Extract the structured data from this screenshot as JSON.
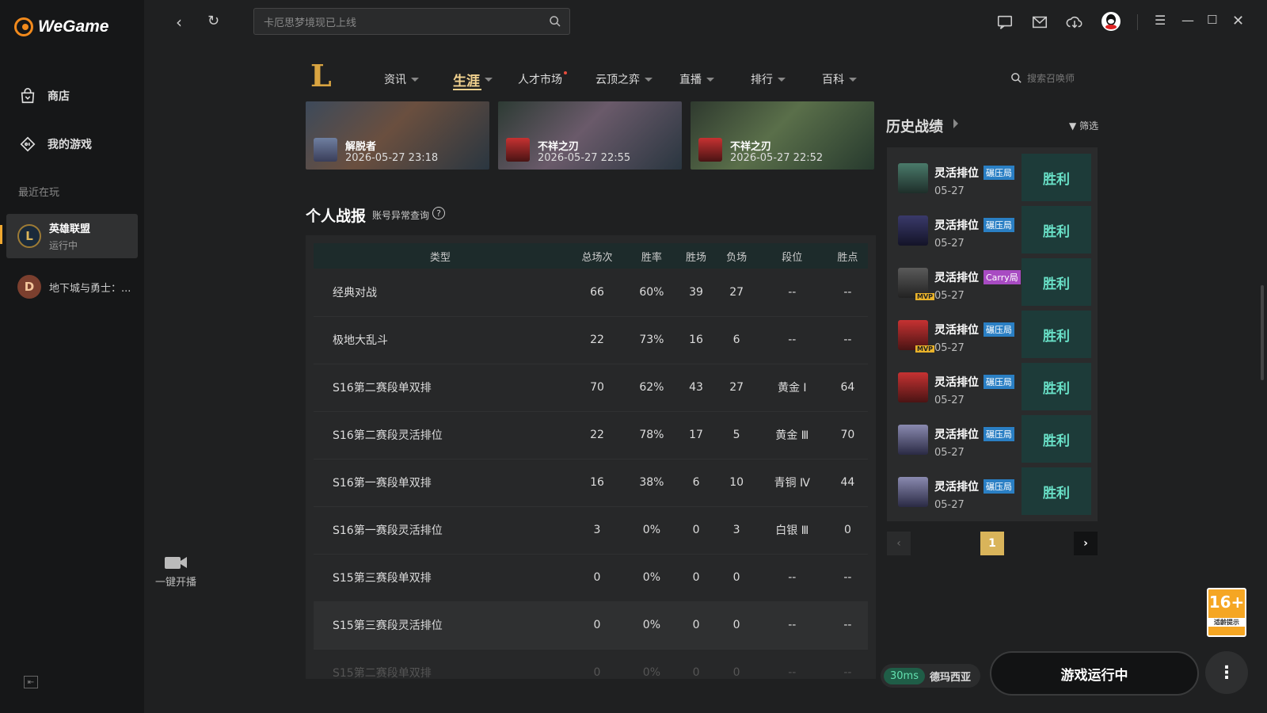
{
  "app": {
    "brand": "WeGame"
  },
  "sidebar": {
    "store": "商店",
    "my_games": "我的游戏",
    "recent_label": "最近在玩",
    "games": [
      {
        "name": "英雄联盟",
        "status": "运行中"
      },
      {
        "name": "地下城与勇士：..."
      }
    ]
  },
  "topbar": {
    "search_placeholder": "卡厄思梦境现已上线"
  },
  "gamenav": {
    "tabs": [
      "资讯",
      "生涯",
      "人才市场",
      "云顶之弈",
      "直播",
      "排行",
      "百科"
    ],
    "summoner_search": "搜索召唤师"
  },
  "videos": [
    {
      "hero": "解脱者",
      "date": "2026-05-27 23:18"
    },
    {
      "hero": "不祥之刃",
      "date": "2026-05-27 22:55"
    },
    {
      "hero": "不祥之刃",
      "date": "2026-05-27 22:52"
    }
  ],
  "personal": {
    "title": "个人战报",
    "query": "账号异常查询",
    "help": "?",
    "headers": [
      "类型",
      "总场次",
      "胜率",
      "胜场",
      "负场",
      "段位",
      "胜点"
    ],
    "rows": [
      [
        "经典对战",
        "66",
        "60%",
        "39",
        "27",
        "--",
        "--"
      ],
      [
        "极地大乱斗",
        "22",
        "73%",
        "16",
        "6",
        "--",
        "--"
      ],
      [
        "S16第二赛段单双排",
        "70",
        "62%",
        "43",
        "27",
        "黄金 Ⅰ",
        "64"
      ],
      [
        "S16第二赛段灵活排位",
        "22",
        "78%",
        "17",
        "5",
        "黄金 Ⅲ",
        "70"
      ],
      [
        "S16第一赛段单双排",
        "16",
        "38%",
        "6",
        "10",
        "青铜 Ⅳ",
        "44"
      ],
      [
        "S16第一赛段灵活排位",
        "3",
        "0%",
        "0",
        "3",
        "白银 Ⅲ",
        "0"
      ],
      [
        "S15第三赛段单双排",
        "0",
        "0%",
        "0",
        "0",
        "--",
        "--"
      ],
      [
        "S15第三赛段灵活排位",
        "0",
        "0%",
        "0",
        "0",
        "--",
        "--"
      ],
      [
        "S15第二赛段单双排",
        "0",
        "0%",
        "0",
        "0",
        "--",
        "--"
      ]
    ]
  },
  "history": {
    "title": "历史战绩",
    "filter": "筛选",
    "matches": [
      {
        "mode": "灵活排位",
        "tag": "碾压局",
        "tag_color": "#2a7fc4",
        "date": "05-27",
        "result": "胜利",
        "mvp": false
      },
      {
        "mode": "灵活排位",
        "tag": "碾压局",
        "tag_color": "#2a7fc4",
        "date": "05-27",
        "result": "胜利",
        "mvp": false
      },
      {
        "mode": "灵活排位",
        "tag": "Carry局",
        "tag_color": "#a84bc2",
        "date": "05-27",
        "result": "胜利",
        "mvp": true
      },
      {
        "mode": "灵活排位",
        "tag": "碾压局",
        "tag_color": "#2a7fc4",
        "date": "05-27",
        "result": "胜利",
        "mvp": true
      },
      {
        "mode": "灵活排位",
        "tag": "碾压局",
        "tag_color": "#2a7fc4",
        "date": "05-27",
        "result": "胜利",
        "mvp": false
      },
      {
        "mode": "灵活排位",
        "tag": "碾压局",
        "tag_color": "#2a7fc4",
        "date": "05-27",
        "result": "胜利",
        "mvp": false
      },
      {
        "mode": "灵活排位",
        "tag": "碾压局",
        "tag_color": "#2a7fc4",
        "date": "05-27",
        "result": "胜利",
        "mvp": false
      }
    ],
    "mvp_label": "MVP",
    "page": "1"
  },
  "bottom": {
    "go_live": "一键开播",
    "ping": "30ms",
    "server": "德玛西亚",
    "running": "游戏运行中",
    "more": "⋮",
    "age_rating": "16+",
    "age_label": "适龄提示"
  }
}
